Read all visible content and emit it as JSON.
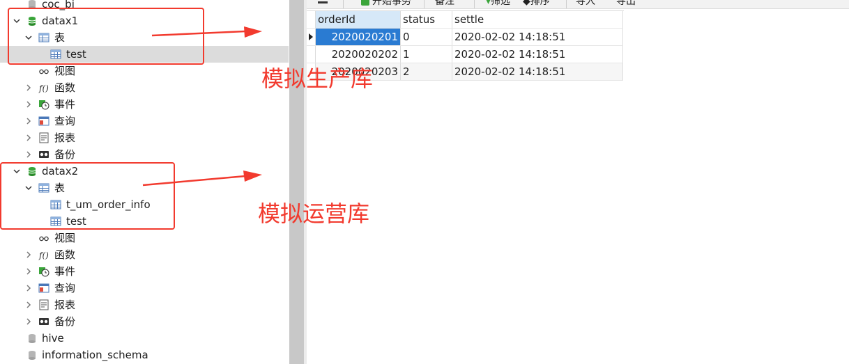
{
  "tree": {
    "top_item": "coc_bi",
    "db1": {
      "name": "datax1",
      "tables_label": "表",
      "tables": [
        "test"
      ],
      "views": "视图",
      "functions": "函数",
      "events": "事件",
      "queries": "查询",
      "reports": "报表",
      "backups": "备份"
    },
    "db2": {
      "name": "datax2",
      "tables_label": "表",
      "tables": [
        "t_um_order_info",
        "test"
      ],
      "views": "视图",
      "functions": "函数",
      "events": "事件",
      "queries": "查询",
      "reports": "报表",
      "backups": "备份"
    },
    "other_dbs": [
      "hive",
      "information_schema"
    ]
  },
  "toolbar": {
    "begin_transaction": "开始事务",
    "memo": "备注",
    "filter": "筛选",
    "sort": "排序",
    "import": "导入",
    "export": "导出"
  },
  "grid": {
    "columns": [
      "orderId",
      "status",
      "settle"
    ],
    "rows": [
      [
        "2020020201",
        "0",
        "2020-02-02 14:18:51"
      ],
      [
        "2020020202",
        "1",
        "2020-02-02 14:18:51"
      ],
      [
        "2020020203",
        "2",
        "2020-02-02 14:18:51"
      ]
    ]
  },
  "annotations": {
    "production": "模拟生产库",
    "operations": "模拟运营库"
  },
  "colors": {
    "annotation_red": "#f23a2e",
    "db_icon_green": "#3aa53a",
    "selection_blue": "#2a7bd2"
  }
}
